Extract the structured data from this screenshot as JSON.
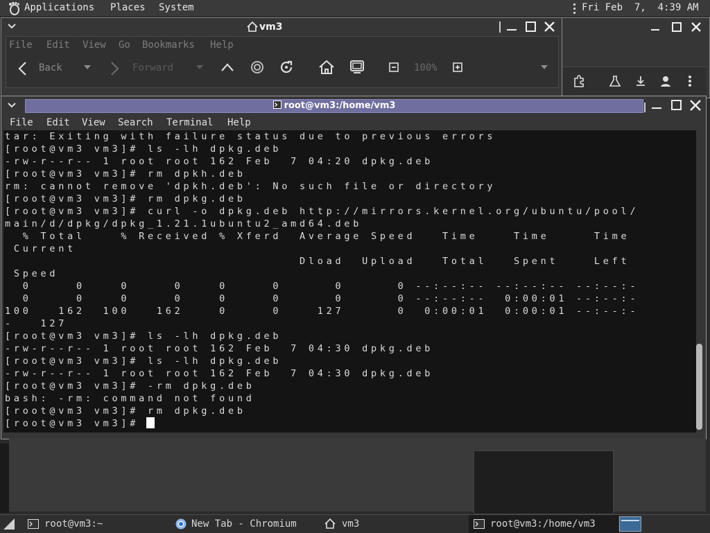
{
  "top_panel": {
    "menus": [
      "Applications",
      "Places",
      "System"
    ],
    "clock": "Fri Feb  7,  4:39 AM"
  },
  "file_manager": {
    "title": "vm3",
    "menus": [
      "File",
      "Edit",
      "View",
      "Go",
      "Bookmarks",
      "Help"
    ],
    "back_label": "Back",
    "forward_label": "Forward",
    "zoom": "100%"
  },
  "terminal": {
    "title": "root@vm3:/home/vm3",
    "menus": [
      "File",
      "Edit",
      "View",
      "Search",
      "Terminal",
      "Help"
    ],
    "lines": [
      "tar: Exiting with failure status due to previous errors",
      "[root@vm3 vm3]# ls -lh dpkg.deb",
      "-rw-r--r-- 1 root root 162 Feb  7 04:20 dpkg.deb",
      "[root@vm3 vm3]# rm dpkh.deb",
      "rm: cannot remove 'dpkh.deb': No such file or directory",
      "[root@vm3 vm3]# rm dpkg.deb",
      "[root@vm3 vm3]# curl -o dpkg.deb http://mirrors.kernel.org/ubuntu/pool/",
      "main/d/dpkg/dpkg_1.21.1ubuntu2_amd64.deb",
      "  % Total    % Received % Xferd  Average Speed   Time    Time     Time",
      " Current",
      "                                 Dload  Upload   Total   Spent    Left",
      " Speed",
      "  0     0    0     0    0     0      0      0 --:--:-- --:--:-- --:--:-",
      "  0     0    0     0    0     0      0      0 --:--:--  0:00:01 --:--:-",
      "100   162  100   162    0     0    127      0  0:00:01  0:00:01 --:--:-",
      "-   127",
      "[root@vm3 vm3]# ls -lh dpkg.deb",
      "-rw-r--r-- 1 root root 162 Feb  7 04:30 dpkg.deb",
      "[root@vm3 vm3]# ls -lh dpkg.deb",
      "-rw-r--r-- 1 root root 162 Feb  7 04:30 dpkg.deb",
      "[root@vm3 vm3]# -rm dpkg.deb",
      "bash: -rm: command not found",
      "[root@vm3 vm3]# rm dpkg.deb"
    ],
    "prompt": "[root@vm3 vm3]# "
  },
  "taskbar": {
    "items": [
      "root@vm3:~",
      "New Tab - Chromium",
      "vm3",
      "root@vm3:/home/vm3"
    ]
  },
  "colors": {
    "terminal_bg": "#141414",
    "active_title": "#6f6e9e",
    "panel": "#3a3a3a"
  }
}
